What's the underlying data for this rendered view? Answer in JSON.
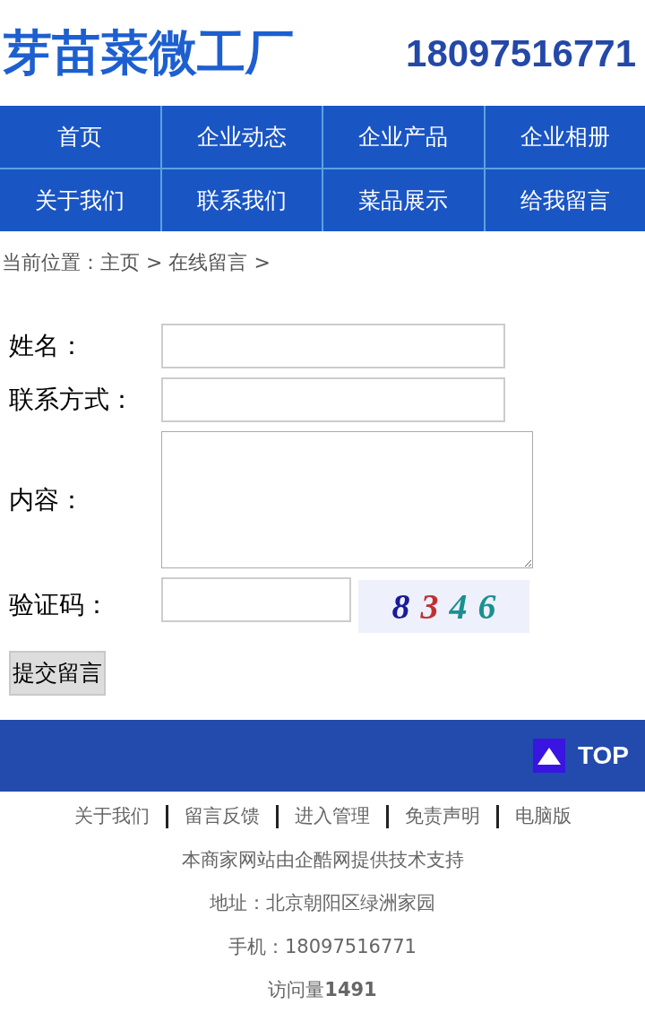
{
  "header": {
    "logo": "芽苗菜微工厂",
    "phone": "18097516771"
  },
  "nav": [
    {
      "label": "首页"
    },
    {
      "label": "企业动态"
    },
    {
      "label": "企业产品"
    },
    {
      "label": "企业相册"
    },
    {
      "label": "关于我们"
    },
    {
      "label": "联系我们"
    },
    {
      "label": "菜品展示"
    },
    {
      "label": "给我留言"
    }
  ],
  "breadcrumb": "当前位置：主页 > 在线留言 >",
  "form": {
    "fields": [
      {
        "label": "姓名：",
        "kind": "input"
      },
      {
        "label": "联系方式：",
        "kind": "input"
      },
      {
        "label": "内容：",
        "kind": "textarea"
      },
      {
        "label": "验证码：",
        "kind": "captcha"
      }
    ],
    "captcha": [
      {
        "char": "8",
        "color": "#1a1a99"
      },
      {
        "char": "3",
        "color": "#c03030"
      },
      {
        "char": "4",
        "color": "#1a9090"
      },
      {
        "char": "6",
        "color": "#1a9090"
      }
    ],
    "submit": "提交留言"
  },
  "top_button": "TOP",
  "footer": {
    "links": [
      "关于我们",
      "留言反馈",
      "进入管理",
      "免责声明",
      "电脑版"
    ],
    "lines": [
      "本商家网站由企酷网提供技术支持",
      "地址：北京朝阳区绿洲家园",
      "手机：18097516771",
      "访问量**1491**"
    ]
  }
}
